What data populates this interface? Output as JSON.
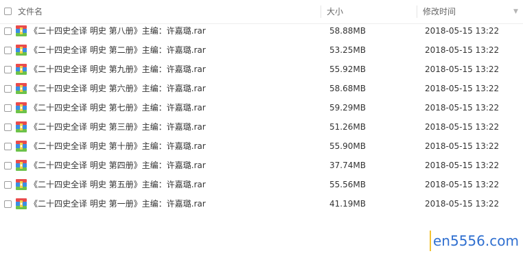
{
  "header": {
    "name_label": "文件名",
    "size_label": "大小",
    "time_label": "修改时间",
    "sort_icon": "chevron-down-icon"
  },
  "file_icon": "rar-archive-icon",
  "files": [
    {
      "name": "《二十四史全译 明史 第八册》主编：许嘉璐.rar",
      "size": "58.88MB",
      "modified": "2018-05-15 13:22"
    },
    {
      "name": "《二十四史全译 明史 第二册》主编：许嘉璐.rar",
      "size": "53.25MB",
      "modified": "2018-05-15 13:22"
    },
    {
      "name": "《二十四史全译 明史 第九册》主编：许嘉璐.rar",
      "size": "55.92MB",
      "modified": "2018-05-15 13:22"
    },
    {
      "name": "《二十四史全译 明史 第六册》主编：许嘉璐.rar",
      "size": "58.68MB",
      "modified": "2018-05-15 13:22"
    },
    {
      "name": "《二十四史全译 明史 第七册》主编：许嘉璐.rar",
      "size": "59.29MB",
      "modified": "2018-05-15 13:22"
    },
    {
      "name": "《二十四史全译 明史 第三册》主编：许嘉璐.rar",
      "size": "51.26MB",
      "modified": "2018-05-15 13:22"
    },
    {
      "name": "《二十四史全译 明史 第十册》主编：许嘉璐.rar",
      "size": "55.90MB",
      "modified": "2018-05-15 13:22"
    },
    {
      "name": "《二十四史全译 明史 第四册》主编：许嘉璐.rar",
      "size": "37.74MB",
      "modified": "2018-05-15 13:22"
    },
    {
      "name": "《二十四史全译 明史 第五册》主编：许嘉璐.rar",
      "size": "55.56MB",
      "modified": "2018-05-15 13:22"
    },
    {
      "name": "《二十四史全译 明史 第一册》主编：许嘉璐.rar",
      "size": "41.19MB",
      "modified": "2018-05-15 13:22"
    }
  ],
  "watermark": "en5556.com",
  "colors": {
    "watermark_text": "#2f6fd0",
    "watermark_bar": "#f3c230",
    "icon_top": "#e94b4b",
    "icon_mid": "#3a8ee6",
    "icon_bottom": "#6cc24a"
  }
}
